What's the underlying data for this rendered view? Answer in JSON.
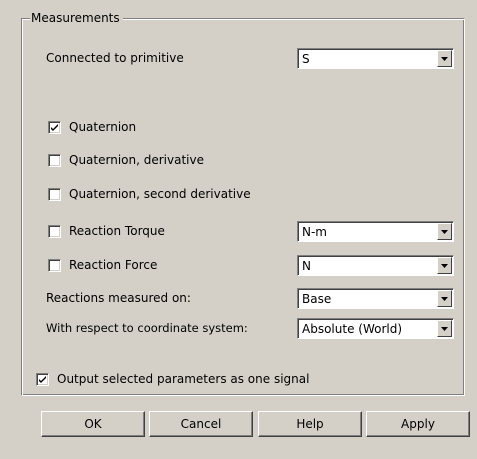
{
  "measurements": {
    "title": "Measurements",
    "connected_label": "Connected to primitive",
    "connected_value": "S",
    "quaternion": {
      "label": "Quaternion",
      "checked": true
    },
    "quaternion_derivative": {
      "label": "Quaternion, derivative",
      "checked": false
    },
    "quaternion_second_derivative": {
      "label": "Quaternion, second derivative",
      "checked": false
    },
    "reaction_torque": {
      "label": "Reaction Torque",
      "checked": false,
      "unit": "N-m"
    },
    "reaction_force": {
      "label": "Reaction Force",
      "checked": false,
      "unit": "N"
    },
    "reactions_measured_label": "Reactions measured on:",
    "reactions_measured_value": "Base",
    "coord_system_label": "With respect to coordinate system:",
    "coord_system_value": "Absolute (World)",
    "output_one_signal": {
      "label": "Output selected parameters as one signal",
      "checked": true
    }
  },
  "buttons": {
    "ok": "OK",
    "cancel": "Cancel",
    "help": "Help",
    "apply": "Apply"
  },
  "icons": {
    "dropdown": "chevron-down-icon",
    "check": "checkmark-icon"
  }
}
